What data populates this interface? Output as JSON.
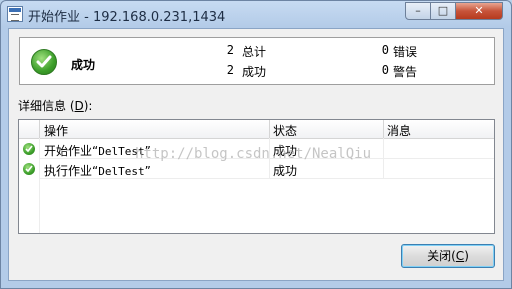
{
  "window": {
    "title": "开始作业 - 192.168.0.231,1434",
    "controls": {
      "minimize": "–",
      "maximize": "□",
      "close": "✕"
    }
  },
  "summary": {
    "status": "成功",
    "total_count": "2",
    "total_label": "总计",
    "success_count": "2",
    "success_label": "成功",
    "error_count": "0",
    "error_label": "错误",
    "warning_count": "0",
    "warning_label": "警告"
  },
  "details": {
    "label_prefix": "详细信息 (",
    "label_accel": "D",
    "label_suffix": "):",
    "columns": {
      "action": "操作",
      "status": "状态",
      "message": "消息"
    },
    "rows": [
      {
        "action_prefix": "开始作业“",
        "action_name": "DelTest",
        "action_suffix": "”",
        "status": "成功",
        "message": ""
      },
      {
        "action_prefix": "执行作业“",
        "action_name": "DelTest",
        "action_suffix": "”",
        "status": "成功",
        "message": ""
      }
    ]
  },
  "buttons": {
    "close_prefix": "关闭(",
    "close_accel": "C",
    "close_suffix": ")"
  },
  "watermark": "http://blog.csdn.net/NealQiu",
  "colors": {
    "success_green": "#3c9e2a",
    "title_bar": "#c7dbf2",
    "close_button_red": "#c7543a"
  }
}
